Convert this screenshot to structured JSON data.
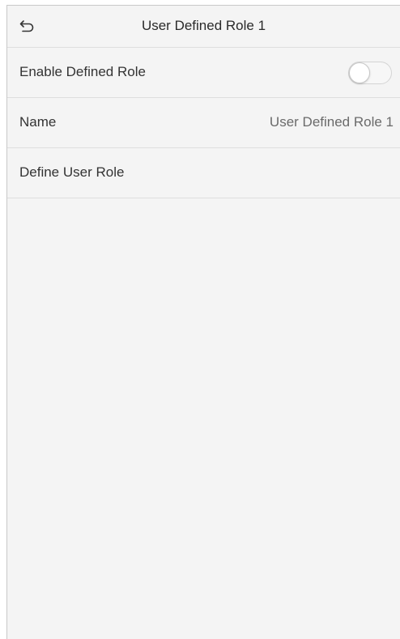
{
  "header": {
    "back_icon": "back-arrow-icon",
    "title": "User Defined Role 1"
  },
  "settings": {
    "enable_role": {
      "label": "Enable Defined Role",
      "toggle_state": "off"
    },
    "name": {
      "label": "Name",
      "value": "User Defined Role 1"
    },
    "define_role": {
      "label": "Define User Role"
    }
  }
}
